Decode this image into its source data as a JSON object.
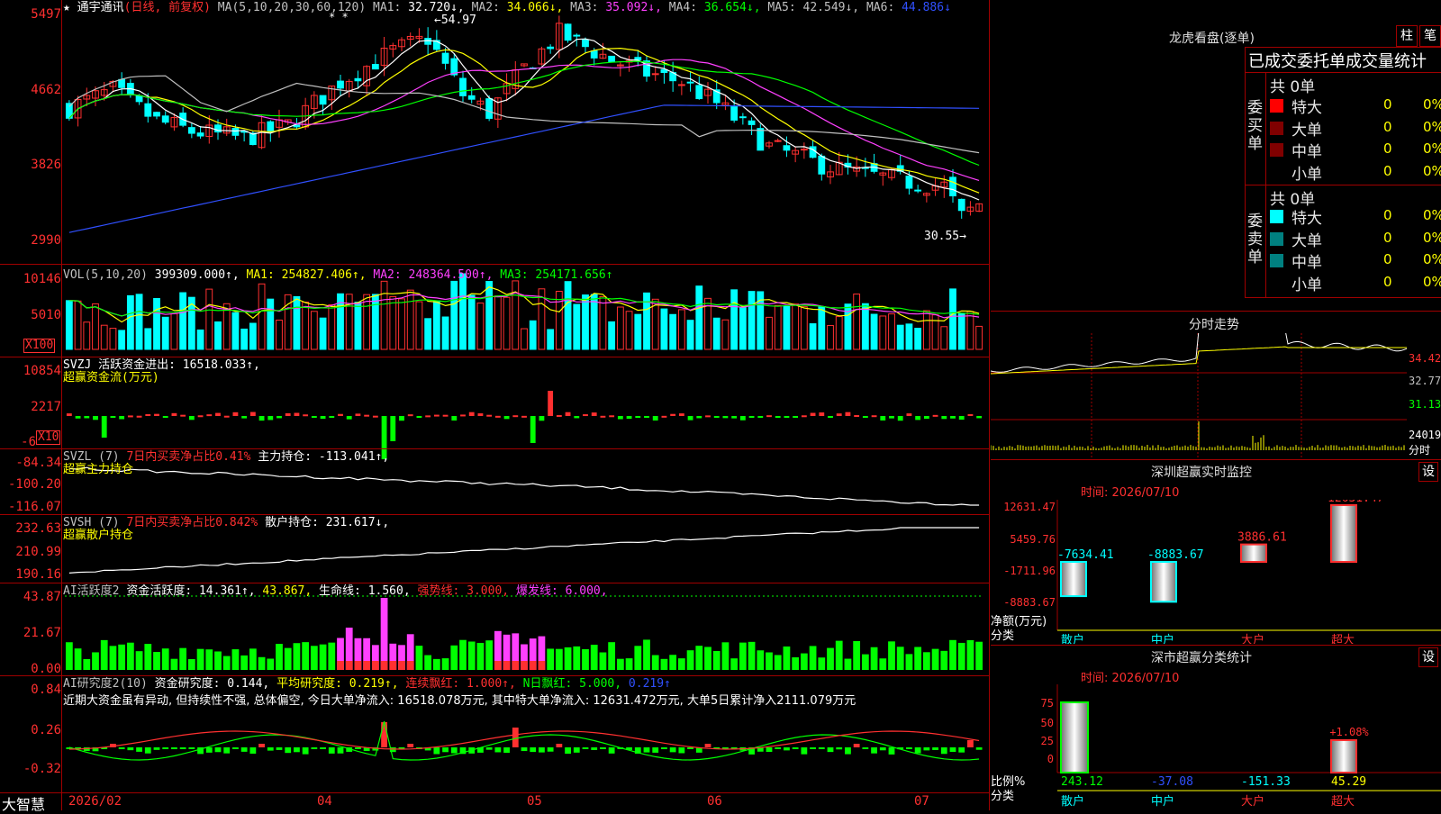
{
  "main": {
    "title": "★ 通宇通讯",
    "period": "(日线, 前复权)",
    "ma_label": "MA(5,10,20,30,60,120)",
    "ma_stars": "* *",
    "ma_values": [
      {
        "label": "MA1:",
        "value": "32.720↓,",
        "color": "#ffffff"
      },
      {
        "label": "MA2:",
        "value": "34.066↓,",
        "color": "#ffff00"
      },
      {
        "label": "MA3:",
        "value": "35.092↓,",
        "color": "#ff40ff"
      },
      {
        "label": "MA4:",
        "value": "36.654↓,",
        "color": "#00ff00"
      },
      {
        "label": "MA5:",
        "value": "42.549↓,",
        "color": "#c0c0c0"
      },
      {
        "label": "MA6:",
        "value": "44.886↓",
        "color": "#3050ff"
      }
    ],
    "high_marker": "←54.97",
    "low_marker": "30.55→",
    "y_ticks": [
      "5497",
      "4662",
      "3826",
      "2990"
    ]
  },
  "vol": {
    "label": "VOL(5,10,20)",
    "value": "399309.000↑,",
    "ma1": "MA1: 254827.406↑,",
    "ma2": "MA2: 248364.500↑,",
    "ma3": "MA3: 254171.656↑",
    "y_ticks": [
      "10146",
      "5010"
    ],
    "unit": "X100"
  },
  "svzj": {
    "label": "SVZJ  活跃资金进出: 16518.033↑,",
    "sub": "超赢资金流(万元)",
    "y_ticks": [
      "10854",
      "2217",
      "-6"
    ],
    "unit": "X10"
  },
  "svzl": {
    "label": "SVZL (7)",
    "ratio": "7日内买卖净占比0.41%",
    "main_hold": "主力持仓: -113.041↑,",
    "sub": "超赢主力持仓",
    "y_ticks": [
      "-84.34",
      "-100.20",
      "-116.07"
    ]
  },
  "svsh": {
    "label": "SVSH (7)",
    "ratio": "7日内买卖净占比0.842%",
    "retail_hold": "散户持仓: 231.617↓,",
    "sub": "超赢散户持仓",
    "y_ticks": [
      "232.63",
      "210.99",
      "190.16"
    ]
  },
  "ai1": {
    "label": "AI活跃度2",
    "activity": "资金活跃度: 14.361↑,",
    "v2": "43.867,",
    "life": "生命线: 1.560,",
    "strong": "强势线: 3.000,",
    "burst": "爆发线: 6.000,",
    "y_ticks": [
      "43.87",
      "21.67",
      "0.00"
    ]
  },
  "ai2": {
    "label": "AI研究度2(10)",
    "research": "资金研究度: 0.144,",
    "avg": "平均研究度: 0.219↑,",
    "cont": "连续飘红: 1.000↑,",
    "nday": "N日飘红: 5.000,",
    "last": "0.219↑",
    "note": "近期大资金虽有异动, 但持续性不强, 总体偏空, 今日大单净流入: 16518.078万元, 其中特大单净流入: 12631.472万元, 大单5日累计净入2111.079万元",
    "y_ticks": [
      "0.84",
      "0.26",
      "-0.32"
    ]
  },
  "bottom": {
    "brand": "大智慧",
    "dates": [
      "2026/02",
      "04",
      "05",
      "06",
      "07"
    ]
  },
  "right": {
    "lhb_title": "龙虎看盘(逐单)",
    "btn1": "柱",
    "btn2": "笔",
    "stat_title": "已成交委托单成交量统计",
    "buy_label": "委买单",
    "sell_label": "委卖单",
    "buy_total": "共 0单",
    "sell_total": "共 0单",
    "rows": [
      {
        "name": "特大",
        "v": "0",
        "p": "0%"
      },
      {
        "name": "大单",
        "v": "0",
        "p": "0%"
      },
      {
        "name": "中单",
        "v": "0",
        "p": "0%"
      },
      {
        "name": "小单",
        "v": "0",
        "p": "0%"
      }
    ],
    "buy_colors": [
      "#ff0000",
      "#800000",
      "#800000",
      "#000000"
    ],
    "sell_colors": [
      "#00ffff",
      "#008080",
      "#008080",
      "#000000"
    ],
    "fs_title": "分时走势",
    "fs_prices": [
      "34.42",
      "32.77",
      "31.13"
    ],
    "fs_vol": "24019",
    "fs_unit": "分时",
    "sz_title": "深圳超赢实时监控",
    "sz_set": "设",
    "sz_time": "时间: 2026/07/10",
    "sz_y": [
      "12631.47",
      "5459.76",
      "-1711.96",
      "-8883.67"
    ],
    "sz_bars": [
      {
        "cat": "散户",
        "value": -7634.41,
        "label": "-7634.41"
      },
      {
        "cat": "中户",
        "value": -8883.67,
        "label": "-8883.67"
      },
      {
        "cat": "大户",
        "value": 3886.61,
        "label": "3886.61"
      },
      {
        "cat": "超大",
        "value": 12631.47,
        "label": "12631.47"
      }
    ],
    "sz_axis_label": "净额(万元)",
    "sz_axis_label2": "分类",
    "cl_title": "深市超赢分类统计",
    "cl_set": "设",
    "cl_time": "时间: 2026/07/10",
    "cl_y": [
      "75",
      "50",
      "25",
      "0"
    ],
    "cl_pct": "+1.08%",
    "cl_vals": [
      "243.12",
      "-37.08",
      "-151.33",
      "45.29"
    ],
    "cl_axis_label": "比例%",
    "cl_axis_label2": "分类",
    "cl_cats": [
      "散户",
      "中户",
      "大户",
      "超大"
    ]
  }
}
